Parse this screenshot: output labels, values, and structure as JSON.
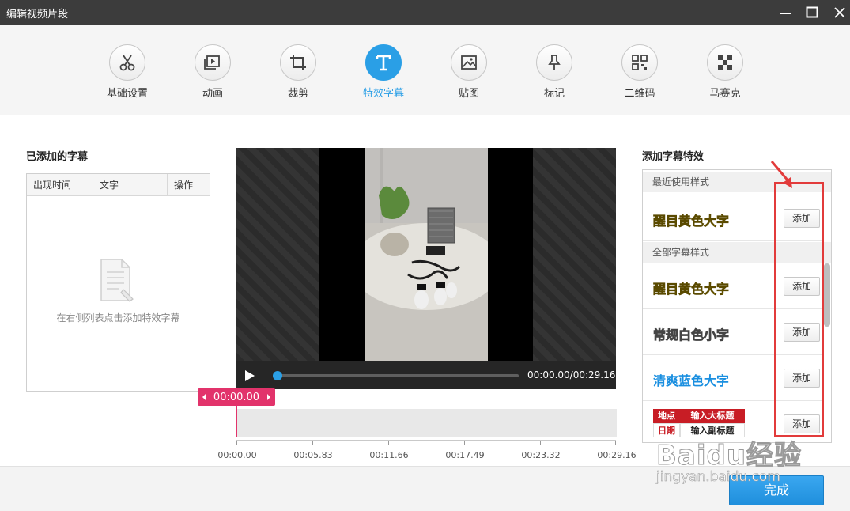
{
  "window": {
    "title": "编辑视频片段"
  },
  "toolbar": {
    "items": [
      {
        "label": "基础设置",
        "icon": "scissors-icon",
        "active": false
      },
      {
        "label": "动画",
        "icon": "animation-icon",
        "active": false
      },
      {
        "label": "裁剪",
        "icon": "crop-icon",
        "active": false
      },
      {
        "label": "特效字幕",
        "icon": "text-icon",
        "active": true
      },
      {
        "label": "贴图",
        "icon": "image-icon",
        "active": false
      },
      {
        "label": "标记",
        "icon": "pin-icon",
        "active": false
      },
      {
        "label": "二维码",
        "icon": "qrcode-icon",
        "active": false
      },
      {
        "label": "马赛克",
        "icon": "mosaic-icon",
        "active": false
      }
    ]
  },
  "left_panel": {
    "title": "已添加的字幕",
    "columns": [
      "出现时间",
      "文字",
      "操作"
    ],
    "empty_text": "在右侧列表点击添加特效字幕"
  },
  "player": {
    "time": "00:00.00/00:29.16",
    "progress": 0.0
  },
  "timeline": {
    "current": "00:00.00",
    "ticks": [
      "00:00.00",
      "00:05.83",
      "00:11.66",
      "00:17.49",
      "00:23.32",
      "00:29.16"
    ]
  },
  "right_panel": {
    "title": "添加字幕特效",
    "recent_header": "最近使用样式",
    "all_header": "全部字幕样式",
    "add_label": "添加",
    "recent": [
      {
        "name": "醒目黄色大字",
        "style": "yellow"
      }
    ],
    "all": [
      {
        "name": "醒目黄色大字",
        "style": "yellow"
      },
      {
        "name": "常规白色小字",
        "style": "white"
      },
      {
        "name": "清爽蓝色大字",
        "style": "blue"
      }
    ],
    "template": {
      "place": "地点",
      "title": "输入大标题",
      "date": "日期",
      "subtitle": "输入副标题"
    }
  },
  "footer": {
    "done_label": "完成"
  },
  "watermark": {
    "main": "Baidu经验",
    "url": "jingyan.baidu.com"
  },
  "colors": {
    "accent": "#2a9fe6",
    "timeline_marker": "#e2336b",
    "annotation": "#e23b3b"
  }
}
